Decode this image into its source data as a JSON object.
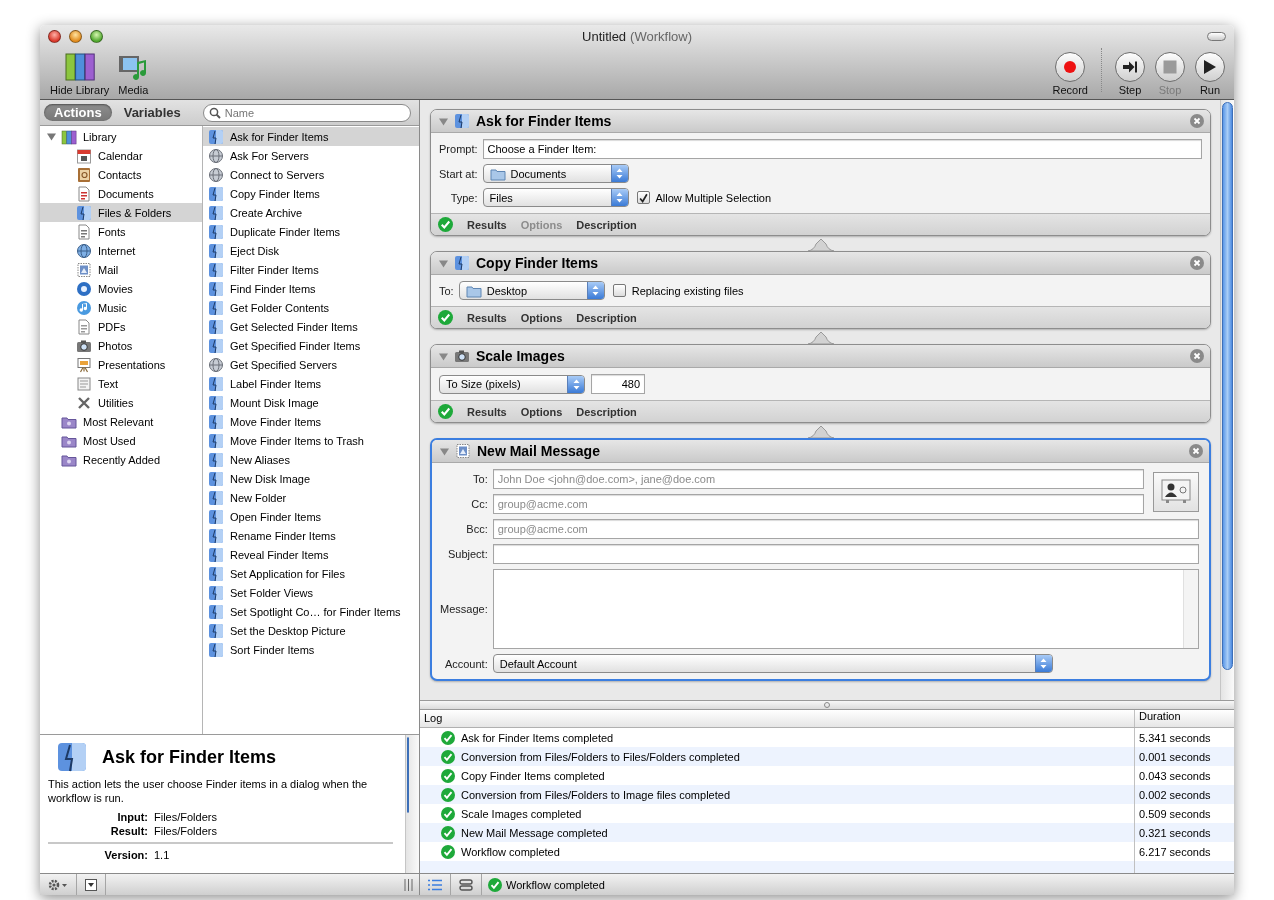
{
  "window": {
    "title": "Untitled",
    "subtitle": "(Workflow)"
  },
  "toolbar_left": [
    {
      "label": "Hide Library",
      "kind": "library"
    },
    {
      "label": "Media",
      "kind": "media"
    }
  ],
  "toolbar_right": [
    {
      "label": "Record",
      "kind": "record",
      "disabled": false
    },
    {
      "label": "Step",
      "kind": "step",
      "disabled": false
    },
    {
      "label": "Stop",
      "kind": "stop",
      "disabled": true
    },
    {
      "label": "Run",
      "kind": "run",
      "disabled": false
    }
  ],
  "library_tabs": [
    {
      "label": "Actions",
      "selected": true
    },
    {
      "label": "Variables",
      "selected": false
    }
  ],
  "search": {
    "placeholder": "Name"
  },
  "categories": [
    {
      "label": "Library",
      "kind": "library",
      "selected": false,
      "expanded": true,
      "children": [
        {
          "label": "Calendar",
          "kind": "calendar",
          "selected": false
        },
        {
          "label": "Contacts",
          "kind": "contacts",
          "selected": false
        },
        {
          "label": "Documents",
          "kind": "documents",
          "selected": false
        },
        {
          "label": "Files & Folders",
          "kind": "finder",
          "selected": true
        },
        {
          "label": "Fonts",
          "kind": "fonts",
          "selected": false
        },
        {
          "label": "Internet",
          "kind": "internet",
          "selected": false
        },
        {
          "label": "Mail",
          "kind": "mail",
          "selected": false
        },
        {
          "label": "Movies",
          "kind": "movies",
          "selected": false
        },
        {
          "label": "Music",
          "kind": "music",
          "selected": false
        },
        {
          "label": "PDFs",
          "kind": "pdfs",
          "selected": false
        },
        {
          "label": "Photos",
          "kind": "photos",
          "selected": false
        },
        {
          "label": "Presentations",
          "kind": "presentations",
          "selected": false
        },
        {
          "label": "Text",
          "kind": "text",
          "selected": false
        },
        {
          "label": "Utilities",
          "kind": "utilities",
          "selected": false
        }
      ]
    },
    {
      "label": "Most Relevant",
      "kind": "smartfolder",
      "selected": false
    },
    {
      "label": "Most Used",
      "kind": "smartfolder",
      "selected": false
    },
    {
      "label": "Recently Added",
      "kind": "smartfolder",
      "selected": false
    }
  ],
  "actions": [
    {
      "label": "Ask for Finder Items",
      "kind": "finder",
      "selected": true
    },
    {
      "label": "Ask For Servers",
      "kind": "server",
      "selected": false
    },
    {
      "label": "Connect to Servers",
      "kind": "server",
      "selected": false
    },
    {
      "label": "Copy Finder Items",
      "kind": "finder",
      "selected": false
    },
    {
      "label": "Create Archive",
      "kind": "finder",
      "selected": false
    },
    {
      "label": "Duplicate Finder Items",
      "kind": "finder",
      "selected": false
    },
    {
      "label": "Eject Disk",
      "kind": "finder",
      "selected": false
    },
    {
      "label": "Filter Finder Items",
      "kind": "finder",
      "selected": false
    },
    {
      "label": "Find Finder Items",
      "kind": "finder",
      "selected": false
    },
    {
      "label": "Get Folder Contents",
      "kind": "finder",
      "selected": false
    },
    {
      "label": "Get Selected Finder Items",
      "kind": "finder",
      "selected": false
    },
    {
      "label": "Get Specified Finder Items",
      "kind": "finder",
      "selected": false
    },
    {
      "label": "Get Specified Servers",
      "kind": "server",
      "selected": false
    },
    {
      "label": "Label Finder Items",
      "kind": "finder",
      "selected": false
    },
    {
      "label": "Mount Disk Image",
      "kind": "finder",
      "selected": false
    },
    {
      "label": "Move Finder Items",
      "kind": "finder",
      "selected": false
    },
    {
      "label": "Move Finder Items to Trash",
      "kind": "finder",
      "selected": false
    },
    {
      "label": "New Aliases",
      "kind": "finder",
      "selected": false
    },
    {
      "label": "New Disk Image",
      "kind": "finder",
      "selected": false
    },
    {
      "label": "New Folder",
      "kind": "finder",
      "selected": false
    },
    {
      "label": "Open Finder Items",
      "kind": "finder",
      "selected": false
    },
    {
      "label": "Rename Finder Items",
      "kind": "finder",
      "selected": false
    },
    {
      "label": "Reveal Finder Items",
      "kind": "finder",
      "selected": false
    },
    {
      "label": "Set Application for Files",
      "kind": "finder",
      "selected": false
    },
    {
      "label": "Set Folder Views",
      "kind": "finder",
      "selected": false
    },
    {
      "label": "Set Spotlight Co… for Finder Items",
      "kind": "finder",
      "selected": false
    },
    {
      "label": "Set the Desktop Picture",
      "kind": "finder",
      "selected": false
    },
    {
      "label": "Sort Finder Items",
      "kind": "finder",
      "selected": false
    }
  ],
  "description": {
    "title": "Ask for Finder Items",
    "kind": "finder",
    "text": "This action lets the user choose Finder items in a dialog when the workflow is run.",
    "details": [
      {
        "label": "Input:",
        "value": "Files/Folders"
      },
      {
        "label": "Result:",
        "value": "Files/Folders"
      }
    ],
    "version": {
      "label": "Version:",
      "value": "1.1"
    }
  },
  "workflow": [
    {
      "title": "Ask for Finder Items",
      "kind": "finder",
      "selected": false,
      "completed": true,
      "rows": [
        {
          "kind": "text",
          "label": "Prompt:",
          "value": "Choose a Finder Item:"
        },
        {
          "kind": "popup",
          "label": "Start at:",
          "value": "Documents",
          "folder": true
        },
        {
          "kind": "popup",
          "label": "Type:",
          "value": "Files",
          "checkbox": {
            "label": "Allow Multiple Selection",
            "checked": true
          }
        }
      ],
      "footer": [
        {
          "label": "Results",
          "disabled": false
        },
        {
          "label": "Options",
          "disabled": true
        },
        {
          "label": "Description",
          "disabled": false
        }
      ]
    },
    {
      "title": "Copy Finder Items",
      "kind": "finder",
      "selected": false,
      "completed": true,
      "rows": [
        {
          "kind": "popup",
          "label": "To:",
          "value": "Desktop",
          "folder": true,
          "checkbox": {
            "label": "Replacing existing files",
            "checked": false
          }
        }
      ],
      "footer": [
        {
          "label": "Results",
          "disabled": false
        },
        {
          "label": "Options",
          "disabled": false
        },
        {
          "label": "Description",
          "disabled": false
        }
      ]
    },
    {
      "title": "Scale Images",
      "kind": "photos",
      "selected": false,
      "completed": true,
      "rows": [
        {
          "kind": "popup",
          "value": "To Size (pixels)",
          "number": "480"
        }
      ],
      "footer": [
        {
          "label": "Results",
          "disabled": false
        },
        {
          "label": "Options",
          "disabled": false
        },
        {
          "label": "Description",
          "disabled": false
        }
      ]
    },
    {
      "title": "New Mail Message",
      "kind": "mail",
      "selected": true,
      "address_book_button": true,
      "rows": [
        {
          "kind": "recipient",
          "label": "To:",
          "placeholder": "John Doe <john@doe.com>, jane@doe.com"
        },
        {
          "kind": "recipient",
          "label": "Cc:",
          "placeholder": "group@acme.com"
        },
        {
          "kind": "text",
          "label": "Bcc:",
          "placeholder": "group@acme.com"
        },
        {
          "kind": "text",
          "label": "Subject:"
        },
        {
          "kind": "textarea",
          "label": "Message:"
        },
        {
          "kind": "popup",
          "label": "Account:",
          "value": "Default Account"
        }
      ]
    }
  ],
  "log": {
    "columns": [
      "Log",
      "Duration"
    ],
    "rows": [
      {
        "message": "Ask for Finder Items completed",
        "duration": "5.341 seconds",
        "completed": true
      },
      {
        "message": "Conversion from Files/Folders to Files/Folders completed",
        "duration": "0.001 seconds",
        "completed": true
      },
      {
        "message": "Copy Finder Items completed",
        "duration": "0.043 seconds",
        "completed": true
      },
      {
        "message": "Conversion from Files/Folders to Image files completed",
        "duration": "0.002 seconds",
        "completed": true
      },
      {
        "message": "Scale Images completed",
        "duration": "0.509 seconds",
        "completed": true
      },
      {
        "message": "New Mail Message completed",
        "duration": "0.321 seconds",
        "completed": true
      },
      {
        "message": "Workflow completed",
        "duration": "6.217 seconds",
        "completed": true
      }
    ]
  },
  "status_bar": {
    "completed": true,
    "text": "Workflow completed"
  }
}
